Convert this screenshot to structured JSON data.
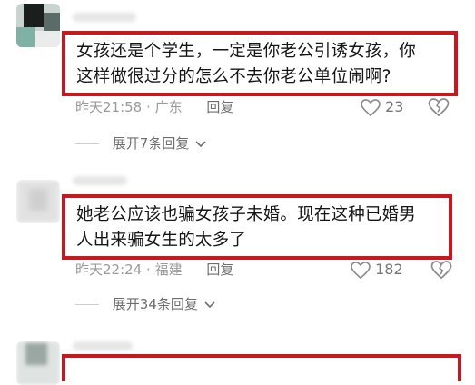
{
  "comments": [
    {
      "text_line1": "女孩还是个学生，一定是你老公引诱女孩，你",
      "text_line2": "这样做很过分的怎么不去你老公单位闹啊?",
      "time": "昨天21:58",
      "location": "广东",
      "reply_label": "回复",
      "likes": "23",
      "expand_label": "展开7条回复"
    },
    {
      "text_line1": "她老公应该也骗女孩子未婚。现在这种已婚男",
      "text_line2": "人出来骗女生的太多了",
      "time": "昨天22:24",
      "location": "福建",
      "reply_label": "回复",
      "likes": "182",
      "expand_label": "展开34条回复"
    },
    {
      "text_line1": "",
      "text_line2": ""
    }
  ],
  "separator": "·",
  "colors": {
    "highlight_border": "#c8171e",
    "meta_text": "#9a9a9a",
    "reply_text": "#6e6e6e"
  },
  "icons": {
    "like": "heart-outline-icon",
    "dislike": "broken-heart-icon",
    "expand": "chevron-down-icon"
  }
}
